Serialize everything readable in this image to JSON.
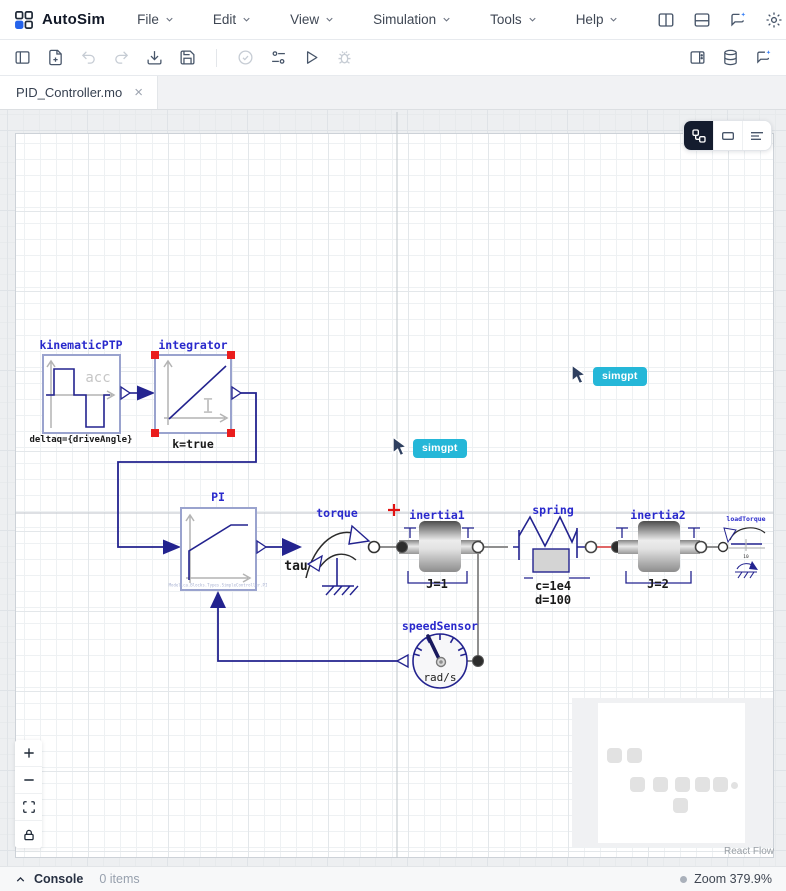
{
  "header": {
    "app_name": "AutoSim",
    "menus": [
      {
        "label": "File"
      },
      {
        "label": "Edit"
      },
      {
        "label": "View"
      },
      {
        "label": "Simulation"
      },
      {
        "label": "Tools"
      },
      {
        "label": "Help"
      }
    ],
    "right_icons": [
      "panel-columns-icon",
      "panel-rows-icon",
      "chat-spark-icon",
      "settings-gear-icon"
    ]
  },
  "toolbar": {
    "left_icons": [
      "panel-left-icon",
      "file-plus-icon",
      "undo-icon",
      "redo-icon",
      "download-icon",
      "save-icon",
      "check-circle-icon",
      "sliders-icon",
      "play-icon",
      "bug-icon"
    ],
    "right_icons": [
      "panel-layout-icon",
      "database-icon",
      "chat-spark-icon"
    ]
  },
  "tabs": [
    {
      "label": "PID_Controller.mo",
      "close_glyph": "×"
    }
  ],
  "canvas": {
    "mode_toggle": {
      "options": [
        "diagram-view",
        "icon-view",
        "text-view"
      ],
      "active": "diagram-view"
    },
    "zoom_controls": [
      "zoom-in",
      "zoom-out",
      "fit-view",
      "lock"
    ],
    "attribution": "React Flow",
    "cursors": [
      {
        "label": "simgpt"
      },
      {
        "label": "simgpt"
      }
    ]
  },
  "diagram": {
    "kinematicPTP": {
      "label": "kinematicPTP",
      "param": "deltaq={driveAngle}",
      "icon_text": "acc"
    },
    "integrator": {
      "label": "integrator",
      "param": "k=true",
      "icon_text": "I"
    },
    "pi": {
      "label": "PI",
      "type_text": "Modelica.Blocks.Types.SimpleController.PI"
    },
    "torque": {
      "label": "torque",
      "tau": "tau"
    },
    "inertia1": {
      "label": "inertia1",
      "param": "J=1"
    },
    "spring": {
      "label": "spring",
      "param_c": "c=1e4",
      "param_d": "d=100"
    },
    "inertia2": {
      "label": "inertia2",
      "param": "J=2"
    },
    "speedSensor": {
      "label": "speedSensor",
      "unit": "rad/s"
    },
    "loadTorque": {
      "label": "loadTorque",
      "value": "10"
    }
  },
  "statusbar": {
    "console": "Console",
    "items": "0 items",
    "zoom": "Zoom 379.9%"
  },
  "colors": {
    "accent_blue": "#2563eb",
    "label_blue": "#2929cc",
    "line_navy": "#23238f",
    "badge_cyan": "#25b7d8",
    "selection_red": "#ea1d1d"
  }
}
